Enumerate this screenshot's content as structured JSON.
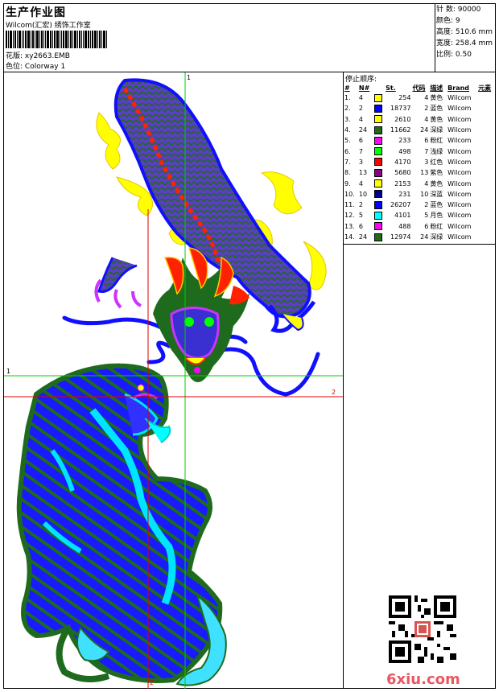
{
  "header": {
    "title": "生产作业图",
    "company": "Wilcom(汇宏) 绣饰工作室",
    "design_label": "花版:",
    "design_value": "xy2663.EMB",
    "colorway_label": "色位:",
    "colorway_value": "Colorway 1"
  },
  "stats": {
    "stitches": "针 数: 90000",
    "colors": "颜色: 9",
    "height": "高度: 510.6 mm",
    "width": "宽度: 258.4 mm",
    "scale": "比例: 0.50"
  },
  "stop_sequence": {
    "title": "停止顺序:",
    "headers": [
      "#",
      "N#",
      "St.",
      "代码",
      "描述",
      "Brand",
      "元素"
    ],
    "rows": [
      {
        "idx": "1.",
        "n": "4",
        "color": "#ffff00",
        "st": "254",
        "code": "4",
        "desc": "黄色",
        "brand": "Wilcom"
      },
      {
        "idx": "2.",
        "n": "2",
        "color": "#0000ff",
        "st": "18737",
        "code": "2",
        "desc": "蓝色",
        "brand": "Wilcom"
      },
      {
        "idx": "3.",
        "n": "4",
        "color": "#ffff00",
        "st": "2610",
        "code": "4",
        "desc": "黄色",
        "brand": "Wilcom"
      },
      {
        "idx": "4.",
        "n": "24",
        "color": "#1e6b1e",
        "st": "11662",
        "code": "24",
        "desc": "深绿",
        "brand": "Wilcom"
      },
      {
        "idx": "5.",
        "n": "6",
        "color": "#ff00ff",
        "st": "233",
        "code": "6",
        "desc": "粉红",
        "brand": "Wilcom"
      },
      {
        "idx": "6.",
        "n": "7",
        "color": "#00ff00",
        "st": "498",
        "code": "7",
        "desc": "浅绿",
        "brand": "Wilcom"
      },
      {
        "idx": "7.",
        "n": "3",
        "color": "#ff0000",
        "st": "4170",
        "code": "3",
        "desc": "红色",
        "brand": "Wilcom"
      },
      {
        "idx": "8.",
        "n": "13",
        "color": "#8b008b",
        "st": "5680",
        "code": "13",
        "desc": "紫色",
        "brand": "Wilcom"
      },
      {
        "idx": "9.",
        "n": "4",
        "color": "#ffff00",
        "st": "2153",
        "code": "4",
        "desc": "黄色",
        "brand": "Wilcom"
      },
      {
        "idx": "10.",
        "n": "10",
        "color": "#00008b",
        "st": "231",
        "code": "10",
        "desc": "深蓝",
        "brand": "Wilcom"
      },
      {
        "idx": "11.",
        "n": "2",
        "color": "#0000ff",
        "st": "26207",
        "code": "2",
        "desc": "蓝色",
        "brand": "Wilcom"
      },
      {
        "idx": "12.",
        "n": "5",
        "color": "#00ffff",
        "st": "4101",
        "code": "5",
        "desc": "月色",
        "brand": "Wilcom"
      },
      {
        "idx": "13.",
        "n": "6",
        "color": "#ff00ff",
        "st": "488",
        "code": "6",
        "desc": "粉红",
        "brand": "Wilcom"
      },
      {
        "idx": "14.",
        "n": "24",
        "color": "#1e6b1e",
        "st": "12974",
        "code": "24",
        "desc": "深绿",
        "brand": "Wilcom"
      }
    ]
  },
  "axes": {
    "v1": "1",
    "h1": "1",
    "h2": "2",
    "v2": "2"
  },
  "watermark": "6xiu.com",
  "colors": {
    "blue": "#1010ff",
    "dark_green": "#1e6b1e",
    "yellow": "#ffff00",
    "red": "#ff0000",
    "cyan": "#00ffff",
    "magenta": "#ff00ff",
    "axis_green": "#00cc00",
    "axis_red": "#e00000"
  }
}
